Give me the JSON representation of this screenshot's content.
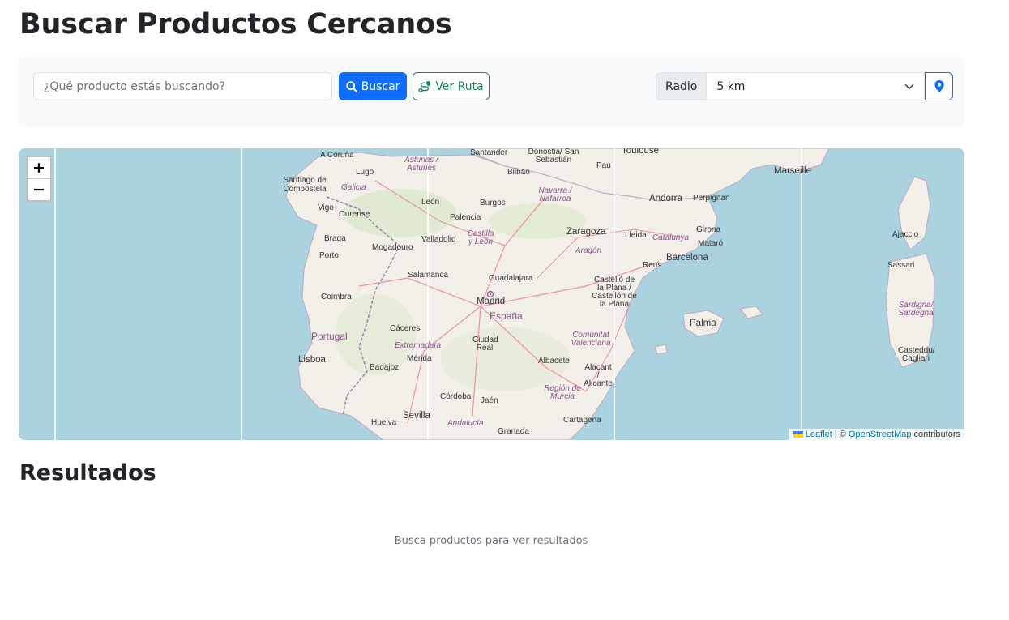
{
  "page": {
    "title": "Buscar Productos Cercanos"
  },
  "search": {
    "placeholder": "¿Qué producto estás buscando?",
    "value": "",
    "search_button": "Buscar",
    "route_button": "Ver Ruta",
    "radius_label": "Radio",
    "radius_value": "5 km"
  },
  "map": {
    "zoom_in": "+",
    "zoom_out": "−",
    "attribution": {
      "leaflet": "Leaflet",
      "sep": "| ©",
      "osm": "OpenStreetMap",
      "suffix": "contributors"
    },
    "places": [
      "A Coruña",
      "Lugo",
      "Santiago de Compostela",
      "Vigo",
      "Ourense",
      "Braga",
      "Porto",
      "Mogadouro",
      "Coimbra",
      "Portugal",
      "Lisboa",
      "Santander",
      "Donostia/ San Sebastián",
      "Bilbao",
      "Pau",
      "Toulouse",
      "Burgos",
      "León",
      "Palencia",
      "Valladolid",
      "Castilla y León",
      "Salamanca",
      "Zaragoza",
      "Aragón",
      "Lleida",
      "Catalunya",
      "Andorra",
      "Perpignan",
      "Girona",
      "Mataró",
      "Barcelona",
      "Reus",
      "Guadalajara",
      "Madrid",
      "España",
      "Castelló de la Plana / Castellón de la Plana",
      "Palma",
      "Cáceres",
      "Extremadura",
      "Mérida",
      "Badajoz",
      "Ciudad Real",
      "Comunitat Valenciana",
      "Albacete",
      "Alacant / Alicante",
      "Región de Murcia",
      "Córdoba",
      "Jaén",
      "Sevilla",
      "Huelva",
      "Andalucía",
      "Granada",
      "Cartagena",
      "Marseille",
      "Ajaccio",
      "Sassari",
      "Sardigna/ Sardegna",
      "Casteddu/ Cagliari",
      "Asturias / Asturies",
      "Galicia",
      "Navarra / Nafarroa"
    ]
  },
  "results": {
    "title": "Resultados",
    "empty_message": "Busca productos para ver resultados"
  },
  "colors": {
    "primary": "#0d6efd",
    "success": "#198754",
    "sea": "#aad3df",
    "land": "#f2efe9"
  }
}
